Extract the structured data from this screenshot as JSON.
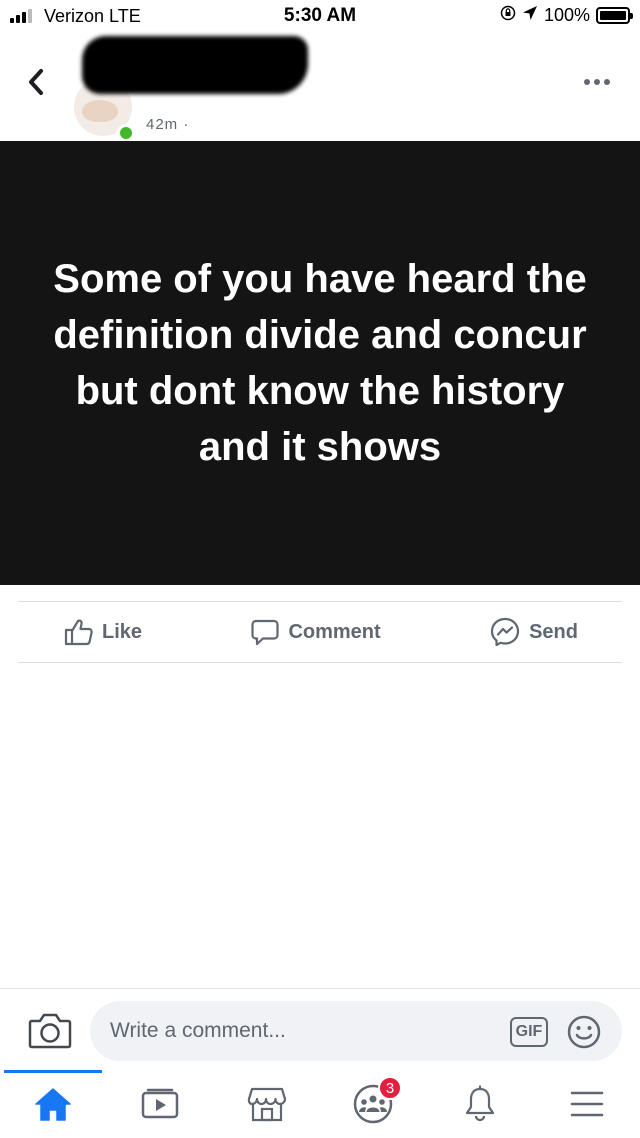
{
  "status_bar": {
    "carrier": "Verizon  LTE",
    "time": "5:30 AM",
    "battery": "100%",
    "battery_level": 1.0
  },
  "post": {
    "meta_fragment": "42m · ",
    "text": "Some of you have heard the definition divide and concur but dont know the history and it shows"
  },
  "actions": {
    "like": "Like",
    "comment": "Comment",
    "send": "Send"
  },
  "composer": {
    "placeholder": "Write a comment...",
    "gif": "GIF"
  },
  "tab_bar": {
    "active": "home",
    "groups_badge": "3"
  },
  "colors": {
    "accent": "#1877f2",
    "post_background": "#141414",
    "online": "#42b72a",
    "badge": "#e41e3f"
  }
}
